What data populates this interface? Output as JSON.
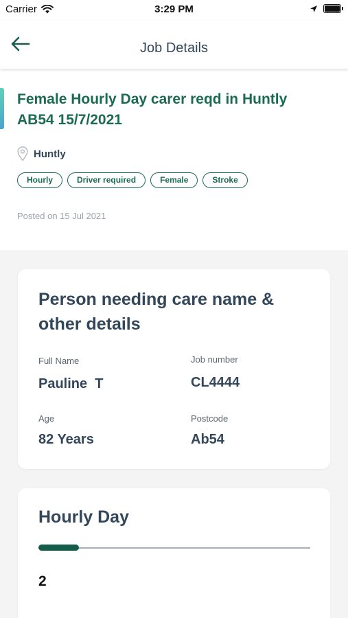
{
  "status_bar": {
    "carrier": "Carrier",
    "time": "3:29 PM"
  },
  "nav": {
    "title": "Job Details",
    "back_icon": "arrow-left-icon"
  },
  "job": {
    "title": "Female Hourly Day carer reqd in Huntly AB54 15/7/2021",
    "location": "Huntly",
    "tags": [
      "Hourly",
      "Driver required",
      "Female",
      "Stroke"
    ],
    "posted": "Posted on 15 Jul 2021",
    "accent_color": "#1b6b53"
  },
  "person_card": {
    "title": "Person needing care name & other details",
    "full_name_label": "Full Name",
    "full_name": "Pauline  T",
    "job_number_label": "Job number",
    "job_number": "CL4444",
    "age_label": "Age",
    "age": "82 Years",
    "postcode_label": "Postcode",
    "postcode": "Ab54"
  },
  "schedule_card": {
    "title": "Hourly Day",
    "progress_fraction": 0.15,
    "value": "2"
  }
}
